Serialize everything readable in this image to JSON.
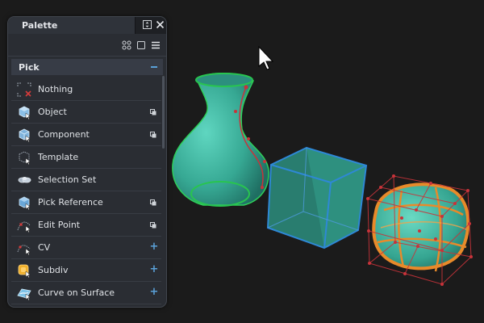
{
  "palette": {
    "title": "Palette",
    "section_title": "Pick",
    "items": [
      {
        "label": "Nothing",
        "icon": "pick-nothing-icon",
        "option": "none"
      },
      {
        "label": "Object",
        "icon": "pick-object-icon",
        "option": "box"
      },
      {
        "label": "Component",
        "icon": "pick-component-icon",
        "option": "box"
      },
      {
        "label": "Template",
        "icon": "pick-template-icon",
        "option": "none"
      },
      {
        "label": "Selection Set",
        "icon": "selection-set-icon",
        "option": "none"
      },
      {
        "label": "Pick Reference",
        "icon": "pick-reference-icon",
        "option": "box"
      },
      {
        "label": "Edit Point",
        "icon": "edit-point-icon",
        "option": "box"
      },
      {
        "label": "CV",
        "icon": "cv-icon",
        "option": "plus"
      },
      {
        "label": "Subdiv",
        "icon": "subdiv-icon",
        "option": "plus"
      },
      {
        "label": "Curve on Surface",
        "icon": "curve-on-surface-icon",
        "option": "plus"
      }
    ],
    "plus_symbol": "+"
  },
  "colors": {
    "background": "#1b1b1b",
    "panel": "#2a2d33",
    "accent_blue": "#5aa1d8",
    "object_teal": "#3fb7a3",
    "selection_orange": "#e88a2a",
    "cv_red": "#c8333a"
  }
}
